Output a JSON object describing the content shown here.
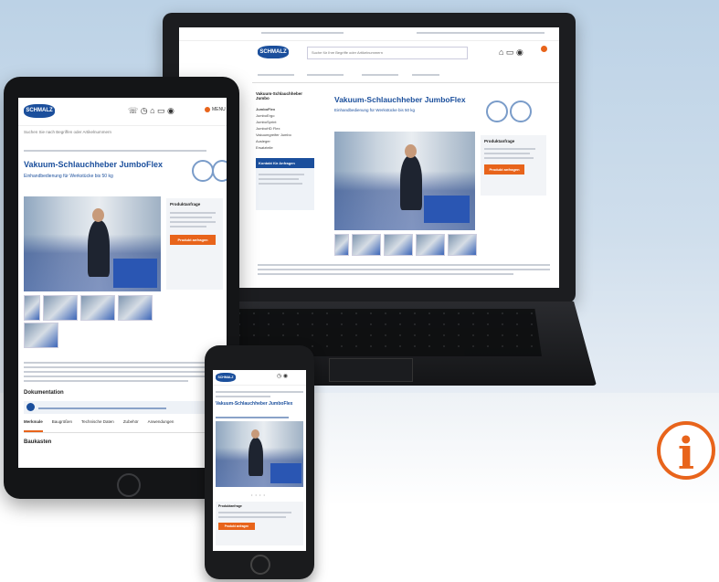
{
  "brand": {
    "logo_text": "SCHMALZ",
    "accent": "#e8641b",
    "primary": "#1b4f9c"
  },
  "laptop": {
    "product_title": "Vakuum-Schlauchheber JumboFlex",
    "subtitle": "Einhandbedienung für Werkstücke bis 50 kg",
    "search_placeholder": "Suche für Ihre Begriffe oder Artikelnummern",
    "sidebar_heading": "Vakuum-Schlauchheber Jumbo",
    "sidebar_items": [
      "JumboFlex",
      "JumboErgo",
      "JumboSprint",
      "JumboHD Flex",
      "Vakuumgreifer Jumbo",
      "Ausleger",
      "Ersatzteile"
    ],
    "contact_box_title": "Kontakt für Anfragen",
    "request_box_title": "Produktanfrage",
    "request_button": "Produkt anfragen"
  },
  "tablet": {
    "product_title": "Vakuum-Schlauchheber JumboFlex",
    "subtitle": "Einhandbedienung für Werkstücke bis 50 kg",
    "search_text": "Suchen Sie nach Begriffen oder Artikelnummern",
    "menu_label": "MENU",
    "request_box_title": "Produktanfrage",
    "request_button": "Produkt anfragen",
    "documents_heading": "Dokumentation",
    "tabs": [
      "Merkmale",
      "Baugrößen",
      "Technische Daten",
      "Zubehör",
      "Anwendungen"
    ],
    "bottom_heading": "Baukasten"
  },
  "phone": {
    "product_title": "Vakuum-Schlauchheber JumboFlex",
    "request_box_title": "Produktanfrage",
    "request_button": "Produkt anfragen"
  },
  "info_icon": "info-icon"
}
